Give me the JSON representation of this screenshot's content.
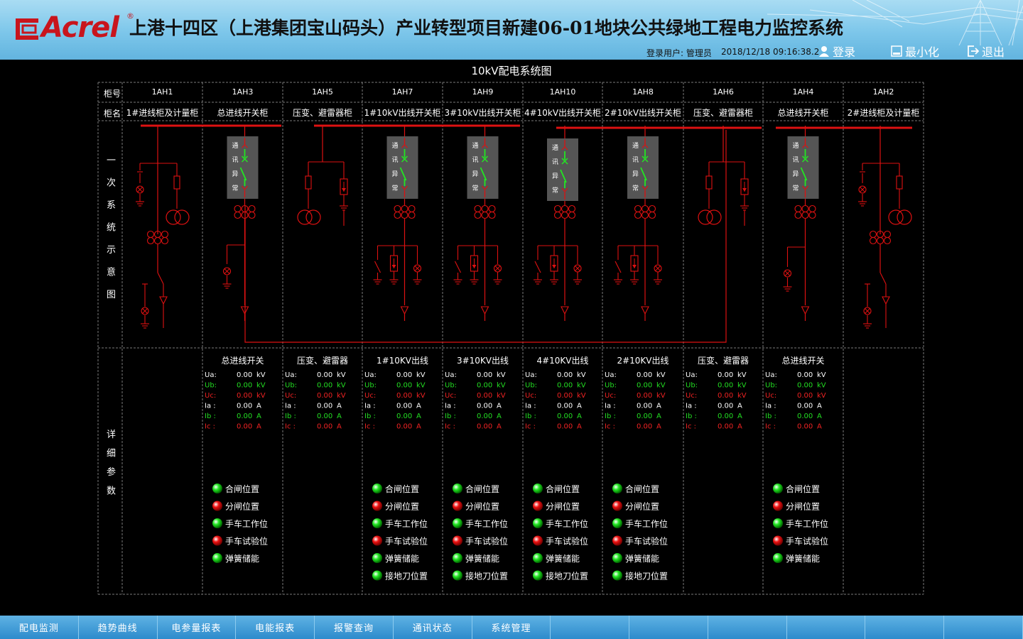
{
  "header": {
    "logo_text": "Acrel",
    "logo_reg": "®",
    "title": "上港十四区（上港集团宝山码头）产业转型项目新建06-01地块公共绿地工程电力监控系统",
    "login_user": "登录用户: 管理员",
    "datetime": "2018/12/18  09:16:38.2",
    "login_label": "登录",
    "minimize_label": "最小化",
    "exit_label": "退出"
  },
  "diagram": {
    "title": "10kV配电系统图",
    "row_labels": {
      "cabinet_no": "柜号",
      "cabinet_name": "柜名",
      "primary": [
        "一",
        "次",
        "系",
        "统",
        "示",
        "意",
        "图"
      ],
      "details": [
        "详",
        "细",
        "参",
        "数"
      ]
    },
    "breaker_box_text": [
      "通",
      "讯",
      "异",
      "常"
    ],
    "cabinets": [
      {
        "id": "1AH1",
        "name": "1#进线柜及计量柜",
        "kind": "incoming-meter-left"
      },
      {
        "id": "1AH3",
        "name": "总进线开关柜",
        "kind": "breaker-main",
        "title": "总进线开关",
        "signals": [
          "合闸位置",
          "分闸位置",
          "手车工作位",
          "手车试验位",
          "弹簧储能"
        ]
      },
      {
        "id": "1AH5",
        "name": "压变、避雷器柜",
        "kind": "pt",
        "title": "压变、避雷器"
      },
      {
        "id": "1AH7",
        "name": "1#10kV出线开关柜",
        "kind": "breaker-feeder",
        "title": "1#10KV出线",
        "signals": [
          "合闸位置",
          "分闸位置",
          "手车工作位",
          "手车试验位",
          "弹簧储能",
          "接地刀位置"
        ]
      },
      {
        "id": "1AH9",
        "name": "3#10kV出线开关柜",
        "kind": "breaker-feeder",
        "title": "3#10KV出线",
        "signals": [
          "合闸位置",
          "分闸位置",
          "手车工作位",
          "手车试验位",
          "弹簧储能",
          "接地刀位置"
        ]
      },
      {
        "id": "1AH10",
        "name": "4#10kV出线开关柜",
        "kind": "breaker-feeder",
        "title": "4#10KV出线",
        "signals": [
          "合闸位置",
          "分闸位置",
          "手车工作位",
          "手车试验位",
          "弹簧储能",
          "接地刀位置"
        ]
      },
      {
        "id": "1AH8",
        "name": "2#10kV出线开关柜",
        "kind": "breaker-feeder",
        "title": "2#10KV出线",
        "signals": [
          "合闸位置",
          "分闸位置",
          "手车工作位",
          "手车试验位",
          "弹簧储能",
          "接地刀位置"
        ]
      },
      {
        "id": "1AH6",
        "name": "压变、避雷器柜",
        "kind": "pt",
        "title": "压变、避雷器"
      },
      {
        "id": "1AH4",
        "name": "总进线开关柜",
        "kind": "breaker-main",
        "title": "总进线开关",
        "signals": [
          "合闸位置",
          "分闸位置",
          "手车工作位",
          "手车试验位",
          "弹簧储能"
        ]
      },
      {
        "id": "1AH2",
        "name": "2#进线柜及计量柜",
        "kind": "incoming-meter-right"
      }
    ],
    "measurements": [
      {
        "label": "Ua:",
        "value": "0.00",
        "unit": "kV",
        "color": "#ffffff"
      },
      {
        "label": "Ub:",
        "value": "0.00",
        "unit": "kV",
        "color": "#22dd22"
      },
      {
        "label": "Uc:",
        "value": "0.00",
        "unit": "kV",
        "color": "#ee2222"
      },
      {
        "label": "Ia :",
        "value": "0.00",
        "unit": "A",
        "color": "#ffffff"
      },
      {
        "label": "Ib :",
        "value": "0.00",
        "unit": "A",
        "color": "#22dd22"
      },
      {
        "label": "Ic :",
        "value": "0.00",
        "unit": "A",
        "color": "#ee2222"
      }
    ],
    "signal_colors": {
      "合闸位置": "green",
      "分闸位置": "red",
      "手车工作位": "green",
      "手车试验位": "red",
      "弹簧储能": "green",
      "接地刀位置": "green"
    },
    "colors": {
      "line": "#dd1111",
      "grid": "#7a7a7a",
      "green": "#22e622",
      "red": "#ee1111",
      "box": "#555555"
    }
  },
  "nav": {
    "items": [
      "配电监测",
      "趋势曲线",
      "电参量报表",
      "电能报表",
      "报警查询",
      "通讯状态",
      "系统管理",
      "",
      "",
      "",
      "",
      "",
      ""
    ]
  }
}
